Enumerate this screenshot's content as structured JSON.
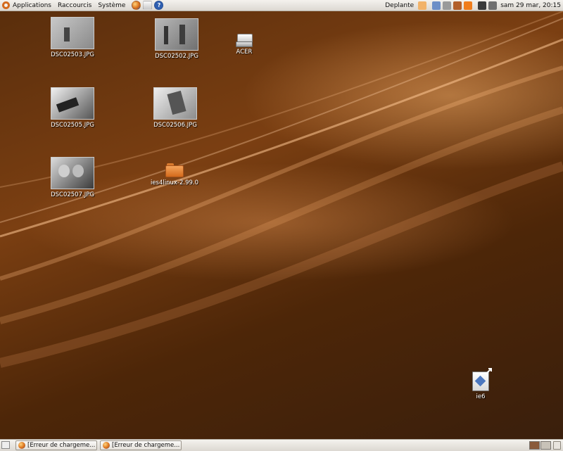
{
  "top_panel": {
    "menus": [
      "Applications",
      "Raccourcis",
      "Système"
    ],
    "user": "Deplante",
    "clock": "sam 29 mar, 20:15"
  },
  "desktop": {
    "icons": [
      {
        "label": "DSC02503.JPG",
        "type": "image"
      },
      {
        "label": "DSC02502.JPG",
        "type": "image"
      },
      {
        "label": "ACER",
        "type": "drive"
      },
      {
        "label": "DSC02505.JPG",
        "type": "image"
      },
      {
        "label": "DSC02506.JPG",
        "type": "image"
      },
      {
        "label": "DSC02507.JPG",
        "type": "image"
      },
      {
        "label": "ies4linux-2.99.0",
        "type": "folder"
      },
      {
        "label": "ie6",
        "type": "launcher-link"
      }
    ]
  },
  "bottom_panel": {
    "tasks": [
      {
        "label": "[Erreur de chargeme..."
      },
      {
        "label": "[Erreur de chargeme..."
      }
    ]
  },
  "colors": {
    "panel": "#ebe8e3",
    "accent": "#d46b1e",
    "wallpaper_dark": "#3a1f0c",
    "wallpaper_light": "#f0a060"
  }
}
